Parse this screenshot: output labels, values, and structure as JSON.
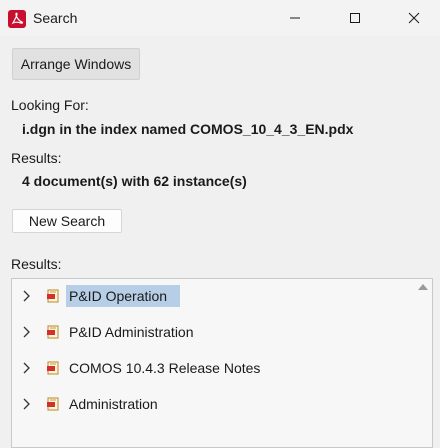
{
  "window": {
    "title": "Search"
  },
  "toolbar": {
    "arrange_label": "Arrange Windows"
  },
  "looking_for": {
    "label": "Looking For:",
    "value": "i.dgn in the index named COMOS_10_4_3_EN.pdx"
  },
  "results_summary": {
    "label": "Results:",
    "value": "4 document(s) with 62 instance(s)"
  },
  "new_search_label": "New Search",
  "results_list": {
    "label": "Results:",
    "items": [
      {
        "label": "P&ID Operation",
        "selected": true
      },
      {
        "label": "P&ID Administration",
        "selected": false
      },
      {
        "label": "COMOS 10.4.3 Release Notes",
        "selected": false
      },
      {
        "label": "Administration",
        "selected": false
      }
    ]
  },
  "colors": {
    "brand": "#c8102e",
    "selection": "#b7cfe6"
  },
  "icons": [
    "pdf-app-icon",
    "minimize-icon",
    "maximize-icon",
    "close-icon",
    "chevron-right-icon",
    "pdf-document-icon",
    "scroll-up-icon"
  ]
}
